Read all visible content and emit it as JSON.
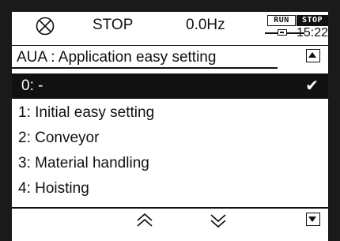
{
  "status": {
    "state": "STOP",
    "frequency": "0.0Hz",
    "run_badge": "RUN",
    "stop_badge": "STOP",
    "time": "15:22"
  },
  "header": {
    "title": "AUA  :  Application easy setting"
  },
  "list": {
    "items": [
      {
        "label": "0: -",
        "selected": true
      },
      {
        "label": "1:  Initial easy setting"
      },
      {
        "label": "2:  Conveyor"
      },
      {
        "label": "3:  Material handling"
      },
      {
        "label": "4:  Hoisting"
      }
    ],
    "check_glyph": "✔"
  },
  "icons": {
    "status": "stop-circle-icon",
    "scroll_up": "scroll-up-icon",
    "scroll_down": "scroll-down-icon",
    "page_up": "double-chevron-up-icon",
    "page_down": "double-chevron-down-icon",
    "battery": "battery-icon",
    "selected": "checkmark-icon"
  }
}
